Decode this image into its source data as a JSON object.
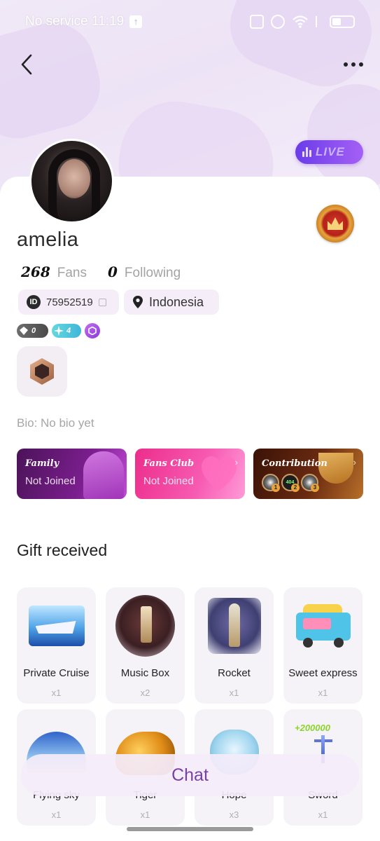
{
  "status_bar": {
    "carrier_time": "No service 11:19",
    "notification_glyph": "↑"
  },
  "nav": {
    "back_icon": "chevron-left-icon",
    "more_icon": "more-horizontal-icon"
  },
  "live_badge": {
    "label": "LIVE"
  },
  "profile": {
    "username": "amelia",
    "fans_count": "268",
    "fans_label": "Fans",
    "following_count": "0",
    "following_label": "Following",
    "id_mark": "ID",
    "id_value": "75952519",
    "location": "Indonesia",
    "diamond_level": "0",
    "star_level": "4",
    "bio": "Bio: No bio yet"
  },
  "features": [
    {
      "title": "Family",
      "subtitle": "Not Joined"
    },
    {
      "title": "Fans Club",
      "subtitle": "Not Joined"
    },
    {
      "title": "Contribution",
      "ranks": [
        "1",
        "2",
        "3"
      ],
      "avatar2_text": "404"
    }
  ],
  "gifts": {
    "title": "Gift received",
    "items": [
      {
        "name": "Private Cruise",
        "count": "x1"
      },
      {
        "name": "Music Box",
        "count": "x2"
      },
      {
        "name": "Rocket",
        "count": "x1"
      },
      {
        "name": "Sweet express",
        "count": "x1"
      },
      {
        "name": "Flying sky",
        "count": "x1"
      },
      {
        "name": "Tiger",
        "count": "x1"
      },
      {
        "name": "Hope",
        "count": "x3"
      },
      {
        "name": "Sword",
        "count": "x1",
        "art_text": "+200000"
      }
    ]
  },
  "chat": {
    "label": "Chat"
  },
  "colors": {
    "accent_purple": "#7a3fa8",
    "live_gradient_start": "#6a3ce8",
    "live_gradient_end": "#a560f5"
  }
}
